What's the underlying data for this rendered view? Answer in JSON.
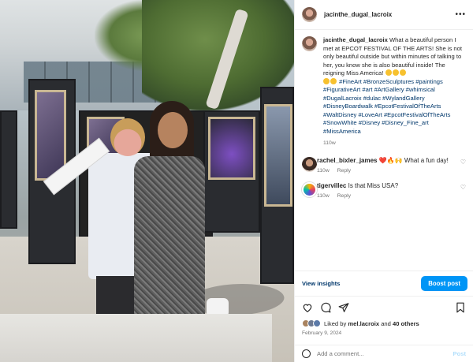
{
  "post": {
    "username": "jacinthe_dugal_lacroix",
    "caption_text": "What a beautiful person I met at EPCOT FESTIVAL OF THE ARTS! She is not only beautiful outside but within minutes of talking to her, you know she is also beautiful inside! The reigning Miss America!",
    "caption_tags": "#FineArt #BronzeSculptures #paintings #FigurativeArt #art #ArtGallery #whimsical #DugalLacroix #dulac #WylandGallery #DisneyBoardwalk #EpcotFestivalOfTheArts #WaltDisney #LoveArt #EpcotFestivalOfTheArts #SnowWhite #Disney #Disney_Fine_art #MissAmerica",
    "caption_time": "110w"
  },
  "comments": [
    {
      "username": "rachel_bixler_james",
      "text": "❤️🔥🙌 What a fun day!",
      "time": "110w",
      "reply": "Reply"
    },
    {
      "username": "tigervillec",
      "text": "Is that Miss USA?",
      "time": "110w",
      "reply": "Reply"
    }
  ],
  "insights": {
    "link": "View insights",
    "boost": "Boost post"
  },
  "likes": {
    "prefix": "Liked by ",
    "user": "mel.lacroix",
    "and": " and ",
    "others": "40 others"
  },
  "date": "February 9, 2024",
  "add_comment": {
    "placeholder": "Add a comment...",
    "post": "Post"
  },
  "icons": [
    "more-icon",
    "heart-icon",
    "comment-icon",
    "share-icon",
    "bookmark-icon",
    "emoji-icon"
  ],
  "colors": {
    "accent": "#0095f6",
    "link": "#00376b",
    "muted": "#737373"
  }
}
